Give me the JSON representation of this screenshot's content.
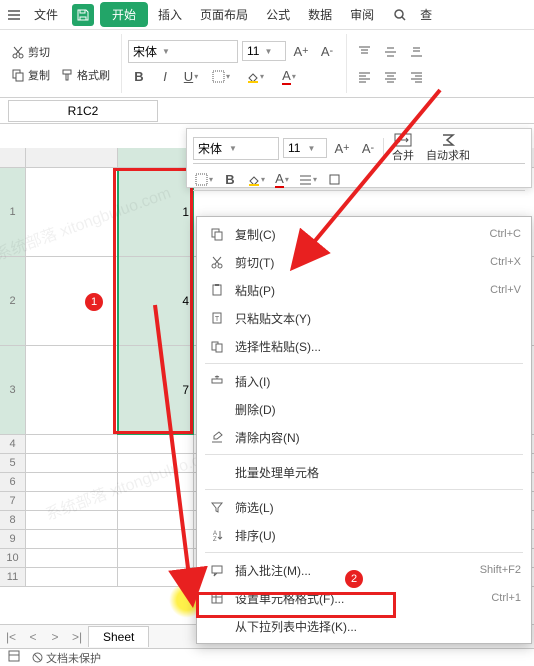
{
  "menu": {
    "file": "文件",
    "start": "开始",
    "insert": "插入",
    "layout": "页面布局",
    "formula": "公式",
    "data": "数据",
    "review": "审阅",
    "search": "查"
  },
  "ribbon": {
    "cut": "剪切",
    "copy": "复制",
    "painter": "格式刷",
    "font": "宋体",
    "size": "11"
  },
  "namebox": "R1C2",
  "minitool": {
    "font": "宋体",
    "size": "11",
    "merge": "合并",
    "autosum": "自动求和"
  },
  "cells": {
    "c1": "1",
    "c2": "4",
    "c3": "7"
  },
  "rows": [
    "1",
    "2",
    "3",
    "4",
    "5",
    "6",
    "7",
    "8",
    "9",
    "10",
    "11"
  ],
  "ctx": {
    "copy": "复制(C)",
    "copy_sc": "Ctrl+C",
    "cut": "剪切(T)",
    "cut_sc": "Ctrl+X",
    "paste": "粘贴(P)",
    "paste_sc": "Ctrl+V",
    "pastetext": "只粘贴文本(Y)",
    "pastespecial": "选择性粘贴(S)...",
    "insert": "插入(I)",
    "delete": "删除(D)",
    "clear": "清除内容(N)",
    "batch": "批量处理单元格",
    "filter": "筛选(L)",
    "sort": "排序(U)",
    "comment": "插入批注(M)...",
    "comment_sc": "Shift+F2",
    "format": "设置单元格格式(F)...",
    "format_sc": "Ctrl+1",
    "dropdown": "从下拉列表中选择(K)..."
  },
  "sheet": "Sheet",
  "status": {
    "protect": "文档未保护"
  },
  "badges": {
    "one": "1",
    "two": "2"
  },
  "watermark": "系统部落 xitongbuluo.com"
}
